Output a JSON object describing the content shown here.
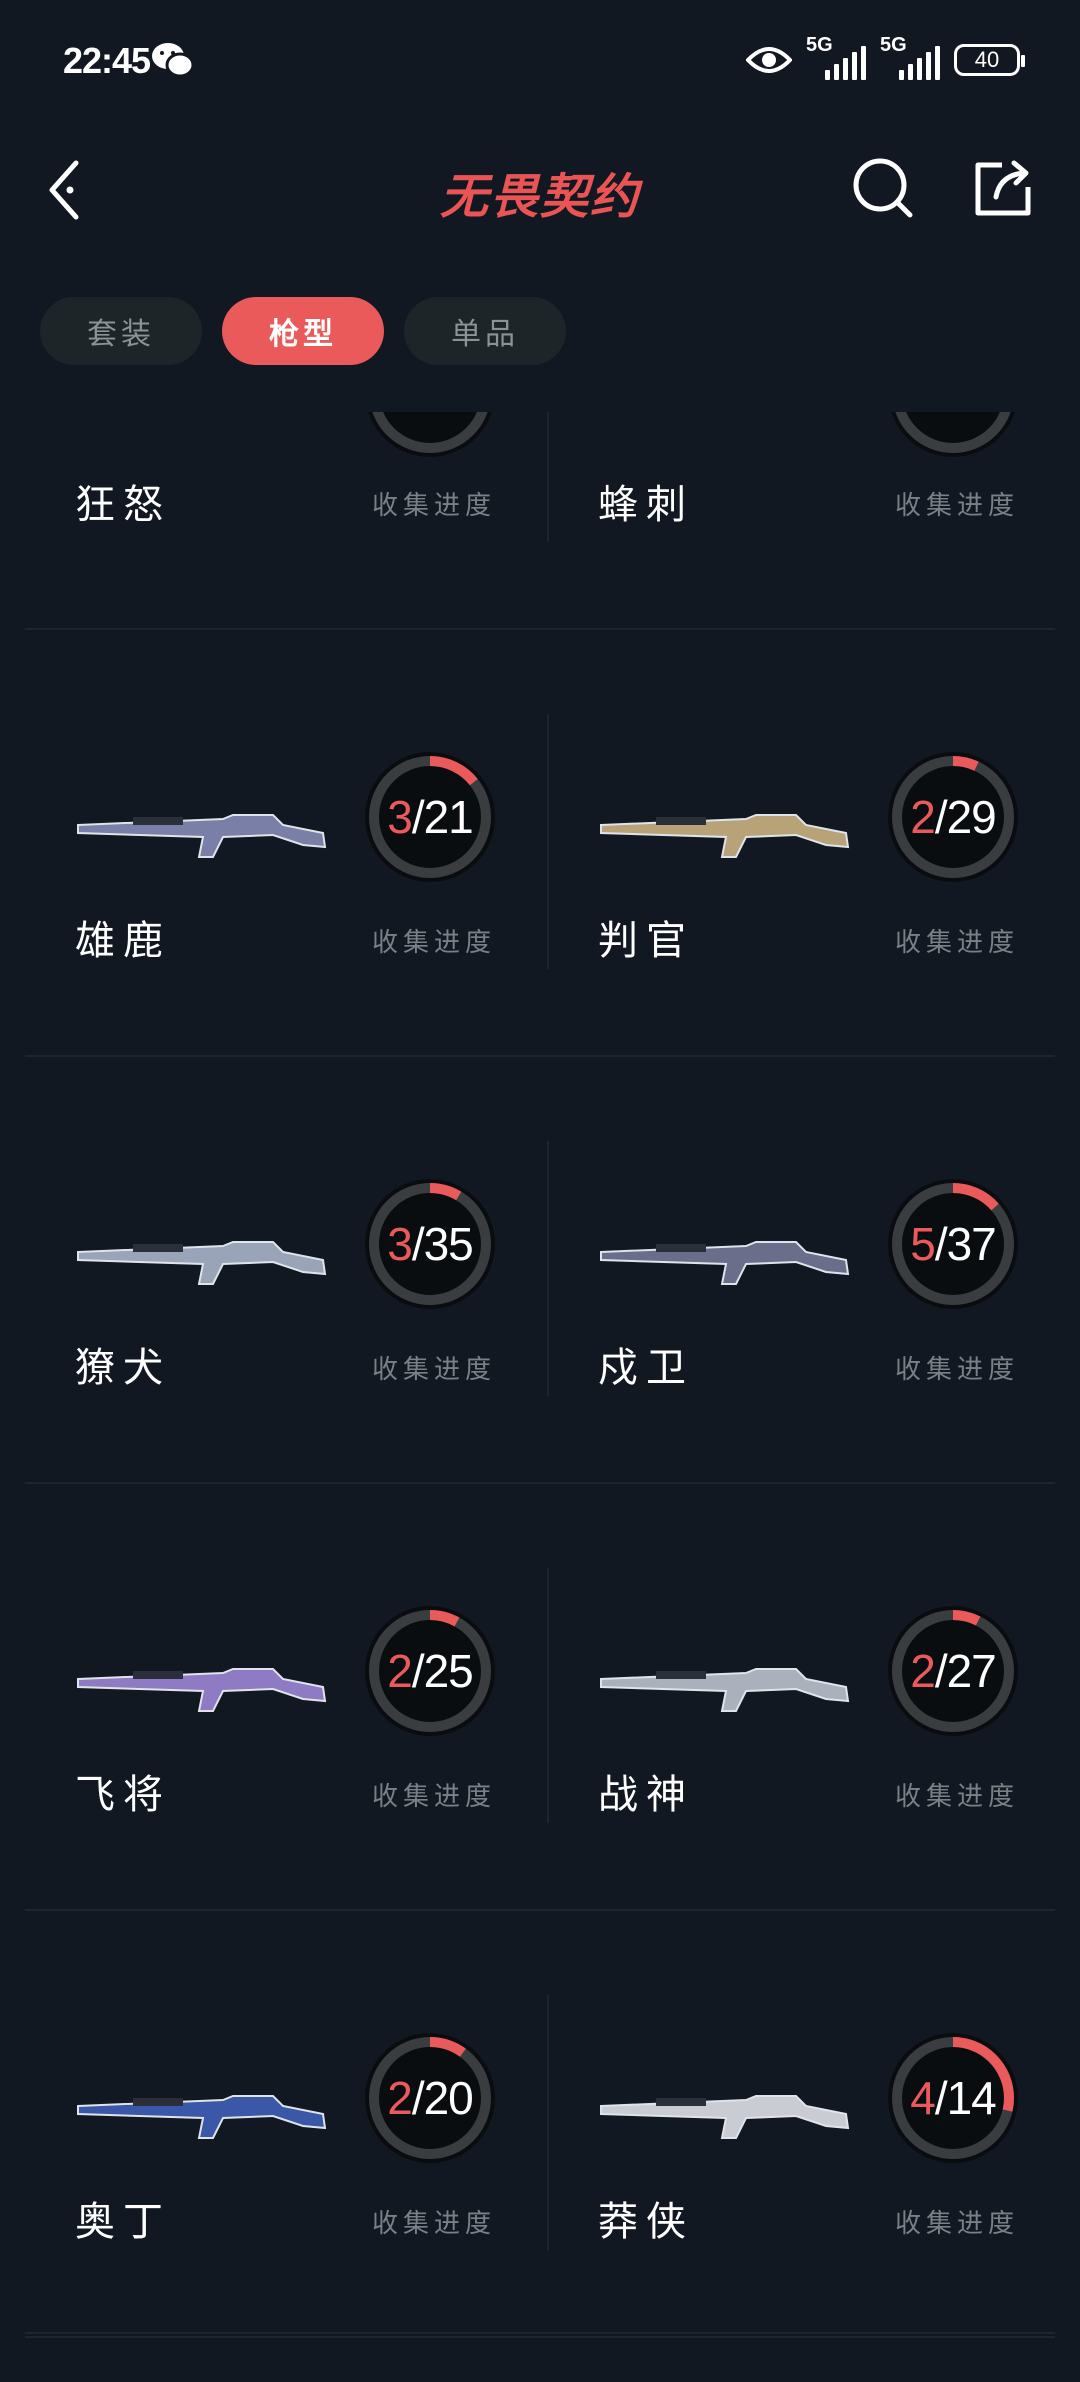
{
  "status": {
    "time": "22:45",
    "sig1": "5G",
    "sig2": "5G",
    "battery": "40"
  },
  "header": {
    "title": "无畏契约"
  },
  "tabs": [
    {
      "label": "套装",
      "active": false
    },
    {
      "label": "枪型",
      "active": true
    },
    {
      "label": "单品",
      "active": false
    }
  ],
  "progress_label": "收集进度",
  "items": [
    {
      "name": "狂怒",
      "current": null,
      "total": null
    },
    {
      "name": "蜂刺",
      "current": null,
      "total": null
    },
    {
      "name": "雄鹿",
      "current": 3,
      "total": 21
    },
    {
      "name": "判官",
      "current": 2,
      "total": 29
    },
    {
      "name": "獠犬",
      "current": 3,
      "total": 35
    },
    {
      "name": "戍卫",
      "current": 5,
      "total": 37
    },
    {
      "name": "飞将",
      "current": 2,
      "total": 25
    },
    {
      "name": "战神",
      "current": 2,
      "total": 27
    },
    {
      "name": "奥丁",
      "current": 2,
      "total": 20
    },
    {
      "name": "莽侠",
      "current": 4,
      "total": 14
    }
  ],
  "colors": {
    "accent": "#ea5a5a",
    "background": "#111821",
    "ring_track": "#3a3d40"
  }
}
